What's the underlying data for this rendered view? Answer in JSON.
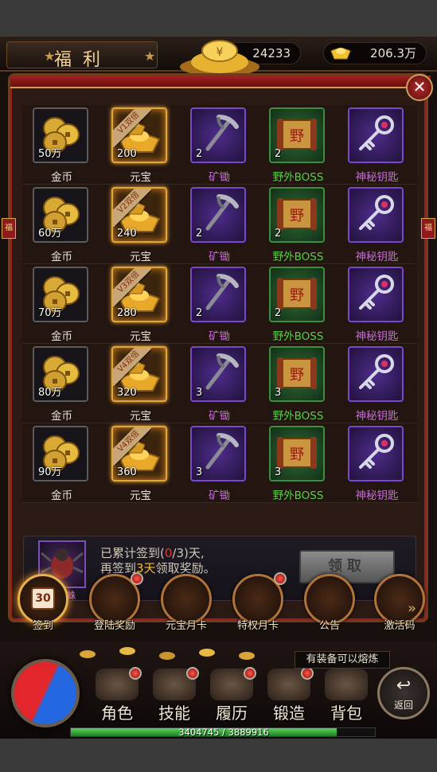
{
  "header": {
    "title": "福利",
    "gold_amount": "24233",
    "ingot_amount": "206.3万",
    "close_glyph": "✕",
    "side_tag": "福"
  },
  "rewards": {
    "rows": [
      {
        "cells": [
          {
            "label": "金币",
            "qty": "50万",
            "style": "dark",
            "icon": "gold-coins-icon"
          },
          {
            "label": "元宝",
            "qty": "200",
            "style": "gold",
            "icon": "gold-ingot-icon",
            "ribbon": "V1双倍"
          },
          {
            "label": "矿锄",
            "qty": "2",
            "style": "purple",
            "icon": "pickaxe-icon"
          },
          {
            "label": "野外BOSS",
            "qty": "2",
            "style": "green",
            "icon": "boss-scroll-icon"
          },
          {
            "label": "神秘钥匙",
            "qty": "",
            "style": "purple",
            "icon": "mystery-key-icon"
          }
        ]
      },
      {
        "cells": [
          {
            "label": "金币",
            "qty": "60万",
            "style": "dark",
            "icon": "gold-coins-icon"
          },
          {
            "label": "元宝",
            "qty": "240",
            "style": "gold",
            "icon": "gold-ingot-icon",
            "ribbon": "V2双倍"
          },
          {
            "label": "矿锄",
            "qty": "2",
            "style": "purple",
            "icon": "pickaxe-icon"
          },
          {
            "label": "野外BOSS",
            "qty": "2",
            "style": "green",
            "icon": "boss-scroll-icon"
          },
          {
            "label": "神秘钥匙",
            "qty": "",
            "style": "purple",
            "icon": "mystery-key-icon"
          }
        ]
      },
      {
        "cells": [
          {
            "label": "金币",
            "qty": "70万",
            "style": "dark",
            "icon": "gold-coins-icon"
          },
          {
            "label": "元宝",
            "qty": "280",
            "style": "gold",
            "icon": "gold-ingot-icon",
            "ribbon": "V3双倍"
          },
          {
            "label": "矿锄",
            "qty": "2",
            "style": "purple",
            "icon": "pickaxe-icon"
          },
          {
            "label": "野外BOSS",
            "qty": "2",
            "style": "green",
            "icon": "boss-scroll-icon"
          },
          {
            "label": "神秘钥匙",
            "qty": "",
            "style": "purple",
            "icon": "mystery-key-icon"
          }
        ]
      },
      {
        "cells": [
          {
            "label": "金币",
            "qty": "80万",
            "style": "dark",
            "icon": "gold-coins-icon"
          },
          {
            "label": "元宝",
            "qty": "320",
            "style": "gold",
            "icon": "gold-ingot-icon",
            "ribbon": "V4双倍"
          },
          {
            "label": "矿锄",
            "qty": "3",
            "style": "purple",
            "icon": "pickaxe-icon"
          },
          {
            "label": "野外BOSS",
            "qty": "3",
            "style": "green",
            "icon": "boss-scroll-icon"
          },
          {
            "label": "神秘钥匙",
            "qty": "",
            "style": "purple",
            "icon": "mystery-key-icon"
          }
        ]
      },
      {
        "cells": [
          {
            "label": "金币",
            "qty": "90万",
            "style": "dark",
            "icon": "gold-coins-icon"
          },
          {
            "label": "元宝",
            "qty": "360",
            "style": "gold",
            "icon": "gold-ingot-icon",
            "ribbon": "V4双倍"
          },
          {
            "label": "矿锄",
            "qty": "3",
            "style": "purple",
            "icon": "pickaxe-icon"
          },
          {
            "label": "野外BOSS",
            "qty": "3",
            "style": "green",
            "icon": "boss-scroll-icon"
          },
          {
            "label": "神秘钥匙",
            "qty": "",
            "style": "purple",
            "icon": "mystery-key-icon"
          }
        ]
      }
    ]
  },
  "signin": {
    "pet_name": "黑蜘蛛",
    "line1_prefix": "已累计签到(",
    "line1_count": "0",
    "line1_suffix": "/3)天,",
    "line2_prefix": "再签到",
    "line2_days": "3天",
    "line2_suffix": "领取奖励。",
    "claim_label": "领取"
  },
  "activities": [
    {
      "label": "签到",
      "badge": "30",
      "active": true,
      "dot": false
    },
    {
      "label": "登陆奖励",
      "active": false,
      "dot": true
    },
    {
      "label": "元宝月卡",
      "active": false,
      "dot": false
    },
    {
      "label": "特权月卡",
      "active": false,
      "dot": true
    },
    {
      "label": "公告",
      "active": false,
      "dot": false
    },
    {
      "label": "激活码",
      "active": false,
      "dot": false
    }
  ],
  "notification": "有装备可以熔炼",
  "bottom_nav": [
    {
      "label": "角色",
      "dot": true
    },
    {
      "label": "技能",
      "dot": true
    },
    {
      "label": "履历",
      "dot": true
    },
    {
      "label": "锻造",
      "dot": true
    },
    {
      "label": "背包",
      "dot": false
    }
  ],
  "back_label": "返回",
  "exp": {
    "current": 3404745,
    "max": 3889916,
    "text": "3404745 / 3889916"
  },
  "colors": {
    "gold_text": "#f2b830",
    "purple_text": "#c56ad9",
    "green_text": "#58d04a",
    "red_text": "#e23b2b"
  }
}
